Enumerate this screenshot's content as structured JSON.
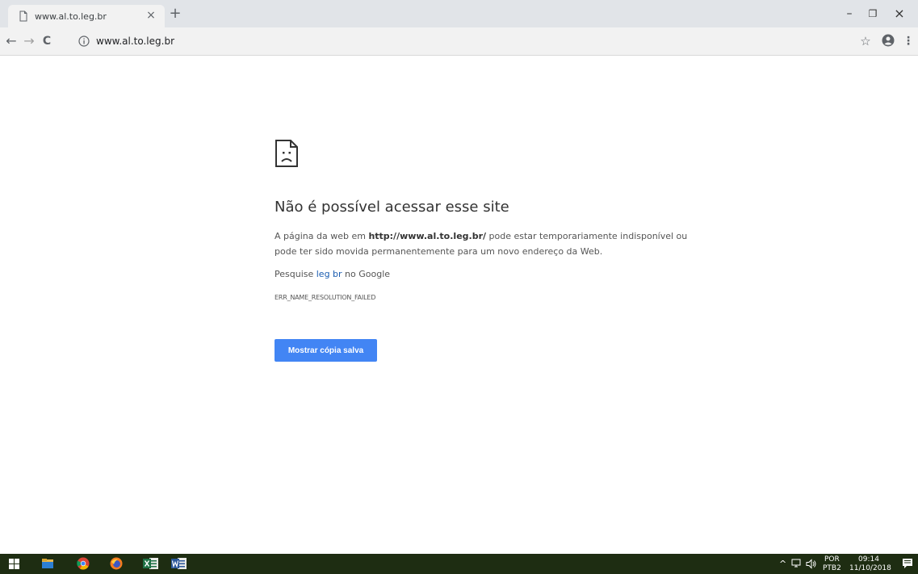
{
  "browser": {
    "tab": {
      "title": "www.al.to.leg.br",
      "close": "×"
    },
    "new_tab": "+",
    "window_controls": {
      "minimize": "–",
      "restore": "❐",
      "close": "×"
    },
    "nav": {
      "back": "←",
      "forward": "→",
      "reload": "C"
    },
    "omnibox": {
      "url": "www.al.to.leg.br"
    },
    "star": "☆",
    "menu": "⋮"
  },
  "error_page": {
    "title": "Não é possível acessar esse site",
    "desc_pre": "A página da web em ",
    "desc_url": "http://www.al.to.leg.br/",
    "desc_post": " pode estar temporariamente indisponível ou pode ter sido movida permanentemente para um novo endereço da Web.",
    "search_pre": "Pesquise ",
    "search_link": "leg br",
    "search_post": " no Google",
    "error_code": "ERR_NAME_RESOLUTION_FAILED",
    "cached_button": "Mostrar cópia salva"
  },
  "taskbar": {
    "language_top": "POR",
    "language_bottom": "PTB2",
    "time": "09:14",
    "date": "11/10/2018",
    "chevron": "^"
  },
  "colors": {
    "button_blue": "#4285f4",
    "link_blue": "#1a5cb0",
    "taskbar": "#1e2d12"
  }
}
